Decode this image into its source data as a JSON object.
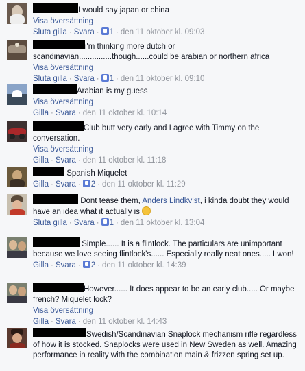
{
  "comments": [
    {
      "text": "I would say japan or china",
      "translate": "Visa översättning",
      "action": "Sluta gilla",
      "reply": "Svara",
      "likes": "1",
      "time": "den 11 oktober kl. 09:03"
    },
    {
      "text": "i'm thinking more dutch or scandinavian...............though......could be arabian or northern africa",
      "translate": "Visa översättning",
      "action": "Sluta gilla",
      "reply": "Svara",
      "likes": "1",
      "time": "den 11 oktober kl. 09:10"
    },
    {
      "text": "Arabian is my guess",
      "translate": "Visa översättning",
      "action": "Gilla",
      "reply": "Svara",
      "time": "den 11 oktober kl. 10:14"
    },
    {
      "text": "Club butt very early and I agree with Timmy on the conversation.",
      "translate": "Visa översättning",
      "action": "Gilla",
      "reply": "Svara",
      "time": "den 11 oktober kl. 11:18"
    },
    {
      "text": "Spanish Miquelet",
      "action": "Gilla",
      "reply": "Svara",
      "likes": "2",
      "time": "den 11 oktober kl. 11:29"
    },
    {
      "text_before": "Dont tease them,",
      "mention": "Anders Lindkvist",
      "text_after": ", i kinda doubt they would have an idea what it actually is",
      "action": "Sluta gilla",
      "reply": "Svara",
      "likes": "1",
      "time": "den 11 oktober kl. 13:04"
    },
    {
      "text": "Simple...... It is a flintlock. The particulars are unimportant because we love seeing flintlock's...... Especially really neat ones..... I won!",
      "action": "Gilla",
      "reply": "Svara",
      "likes": "2",
      "time": "den 11 oktober kl. 14:39"
    },
    {
      "text": "However...... It does appear to be an early club..... Or maybe french? Miquelet lock?",
      "translate": "Visa översättning",
      "action": "Gilla",
      "reply": "Svara",
      "time": "den 11 oktober kl. 14:43"
    },
    {
      "text": "Swedish/Scandinavian Snaplock mechanism rifle regardless of how it is stocked. Snaplocks were used in New Sweden as well. Amazing performance in reality with the combination main & frizzen spring set up."
    }
  ],
  "colors": {
    "link": "#3b5998",
    "meta": "#90949c",
    "background": "#f6f7f9"
  },
  "icons": {
    "like": "thumbs-up-icon",
    "emoticon": "smiley-icon"
  }
}
